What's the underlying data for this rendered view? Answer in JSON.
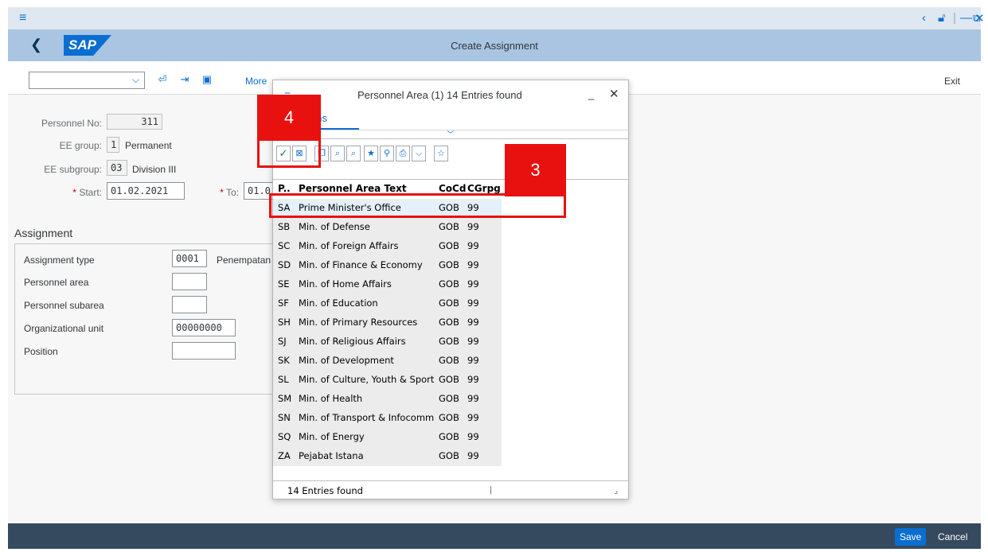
{
  "window": {
    "menu_icon": "≡",
    "controls": [
      "‹",
      "⎘",
      "|",
      "—",
      "⧉",
      "✕"
    ]
  },
  "header": {
    "logo": "SAP",
    "title": "Create Assignment"
  },
  "toolbar": {
    "more_label": "More",
    "exit_label": "Exit"
  },
  "form": {
    "personnel_no_label": "Personnel No:",
    "personnel_no_value": "311",
    "ee_group_label": "EE group:",
    "ee_group_code": "1",
    "ee_group_text": "Permanent",
    "ee_subgroup_label": "EE subgroup:",
    "ee_subgroup_code": "03",
    "ee_subgroup_text": "Division III",
    "start_label": "Start:",
    "start_value": "01.02.2021",
    "to_label": "To:",
    "to_value": "01.0"
  },
  "assignment": {
    "title": "Assignment",
    "type_label": "Assignment type",
    "type_value": "0001",
    "type_text": "Penempatan",
    "personnel_area_label": "Personnel area",
    "personnel_subarea_label": "Personnel subarea",
    "org_unit_label": "Organizational unit",
    "org_unit_value": "00000000",
    "position_label": "Position"
  },
  "footer": {
    "save_label": "Save",
    "cancel_label": "Cancel"
  },
  "popup": {
    "title": "Personnel Area (1)  14 Entries found",
    "tab_label": "ctions",
    "columns": [
      "P..",
      "Personnel Area Text",
      "CoCd",
      "CGrpg"
    ],
    "rows": [
      {
        "code": "SA",
        "text": "Prime Minister's Office",
        "cocd": "GOB",
        "cgrpg": "99"
      },
      {
        "code": "SB",
        "text": "Min. of Defense",
        "cocd": "GOB",
        "cgrpg": "99"
      },
      {
        "code": "SC",
        "text": "Min. of Foreign Affairs",
        "cocd": "GOB",
        "cgrpg": "99"
      },
      {
        "code": "SD",
        "text": "Min. of Finance & Economy",
        "cocd": "GOB",
        "cgrpg": "99"
      },
      {
        "code": "SE",
        "text": "Min. of Home Affairs",
        "cocd": "GOB",
        "cgrpg": "99"
      },
      {
        "code": "SF",
        "text": "Min. of Education",
        "cocd": "GOB",
        "cgrpg": "99"
      },
      {
        "code": "SH",
        "text": "Min. of Primary Resources",
        "cocd": "GOB",
        "cgrpg": "99"
      },
      {
        "code": "SJ",
        "text": "Min. of Religious Affairs",
        "cocd": "GOB",
        "cgrpg": "99"
      },
      {
        "code": "SK",
        "text": "Min. of Development",
        "cocd": "GOB",
        "cgrpg": "99"
      },
      {
        "code": "SL",
        "text": "Min. of Culture, Youth & Sport",
        "cocd": "GOB",
        "cgrpg": "99"
      },
      {
        "code": "SM",
        "text": "Min. of Health",
        "cocd": "GOB",
        "cgrpg": "99"
      },
      {
        "code": "SN",
        "text": "Min. of Transport & Infocomm",
        "cocd": "GOB",
        "cgrpg": "99"
      },
      {
        "code": "SQ",
        "text": "Min. of Energy",
        "cocd": "GOB",
        "cgrpg": "99"
      },
      {
        "code": "ZA",
        "text": "Pejabat Istana",
        "cocd": "GOB",
        "cgrpg": "99"
      }
    ],
    "status": "14 Entries found"
  },
  "callouts": {
    "step_4": "4",
    "step_3": "3"
  },
  "colors": {
    "accent": "#0a6ed1",
    "header_bg": "#a9c5e1",
    "footer_bg": "#354a5f",
    "callout": "#e8110f",
    "selected_row": "#e5f0fa"
  }
}
